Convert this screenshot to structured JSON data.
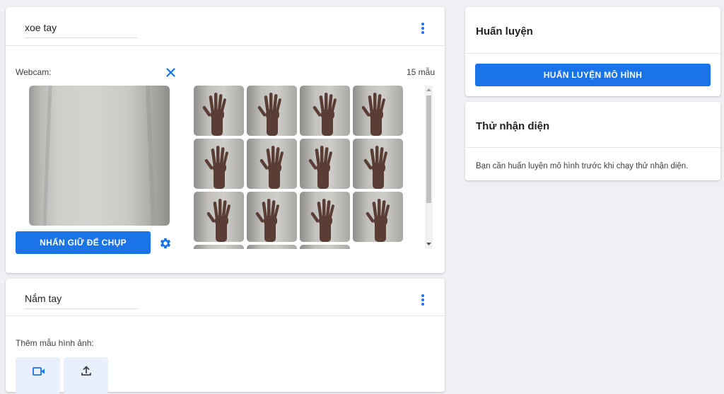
{
  "classes": [
    {
      "name": "xoe tay",
      "webcam_label": "Webcam:",
      "sample_count": "15 mẫu",
      "capture_button": "NHẤN GIỮ ĐỂ CHỤP",
      "thumbnails": 15
    },
    {
      "name": "Nắm tay",
      "add_samples_label": "Thêm mẫu hình ảnh:"
    }
  ],
  "training": {
    "title": "Huấn luyện",
    "button": "HUẤN LUYỆN MÔ HÌNH"
  },
  "preview": {
    "title": "Thử nhận diện",
    "message": "Bạn cần huấn luyện mô hình trước khi chạy thử nhận diện."
  },
  "colors": {
    "accent": "#1a73e8",
    "background": "#eef0f4",
    "card": "#ffffff"
  },
  "icons": [
    "kebab-menu-icon",
    "close-icon",
    "gear-icon",
    "webcam-icon",
    "upload-icon"
  ]
}
